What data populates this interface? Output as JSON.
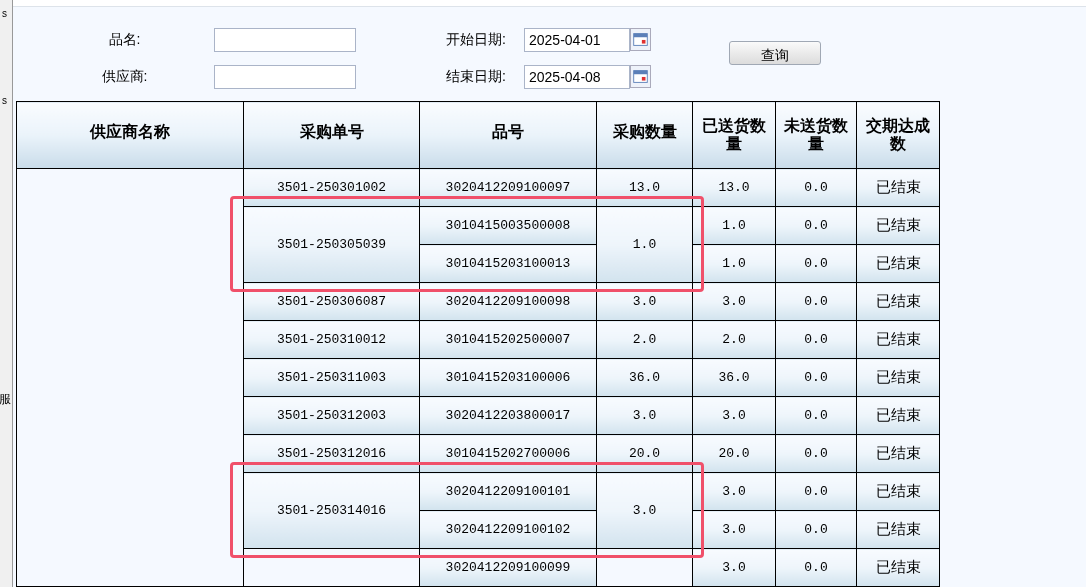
{
  "side_fragments": [
    "s",
    "s",
    "服"
  ],
  "form": {
    "fields": [
      {
        "label": "品名:"
      },
      {
        "label": "供应商:"
      }
    ],
    "dates": [
      {
        "label": "开始日期:",
        "value": "2025-04-01"
      },
      {
        "label": "结束日期:",
        "value": "2025-04-08"
      }
    ],
    "search_button": "查询"
  },
  "table": {
    "columns": [
      "供应商名称",
      "采购单号",
      "品号",
      "采购数量",
      "已送货数量",
      "未送货数量",
      "交期达成数"
    ],
    "orders": [
      {
        "order_no": "3501-250301002",
        "qty": "13.0",
        "highlighted": false,
        "items": [
          {
            "part_no": "3020412209100097",
            "delivered": "13.0",
            "undelivered": "0.0",
            "status": "已结束"
          }
        ]
      },
      {
        "order_no": "3501-250305039",
        "qty": "1.0",
        "highlighted": true,
        "items": [
          {
            "part_no": "3010415003500008",
            "delivered": "1.0",
            "undelivered": "0.0",
            "status": "已结束"
          },
          {
            "part_no": "3010415203100013",
            "delivered": "1.0",
            "undelivered": "0.0",
            "status": "已结束"
          }
        ]
      },
      {
        "order_no": "3501-250306087",
        "qty": "3.0",
        "highlighted": false,
        "items": [
          {
            "part_no": "3020412209100098",
            "delivered": "3.0",
            "undelivered": "0.0",
            "status": "已结束"
          }
        ]
      },
      {
        "order_no": "3501-250310012",
        "qty": "2.0",
        "highlighted": false,
        "items": [
          {
            "part_no": "3010415202500007",
            "delivered": "2.0",
            "undelivered": "0.0",
            "status": "已结束"
          }
        ]
      },
      {
        "order_no": "3501-250311003",
        "qty": "36.0",
        "highlighted": false,
        "items": [
          {
            "part_no": "3010415203100006",
            "delivered": "36.0",
            "undelivered": "0.0",
            "status": "已结束"
          }
        ]
      },
      {
        "order_no": "3501-250312003",
        "qty": "3.0",
        "highlighted": false,
        "items": [
          {
            "part_no": "3020412203800017",
            "delivered": "3.0",
            "undelivered": "0.0",
            "status": "已结束"
          }
        ]
      },
      {
        "order_no": "3501-250312016",
        "qty": "20.0",
        "highlighted": false,
        "items": [
          {
            "part_no": "3010415202700006",
            "delivered": "20.0",
            "undelivered": "0.0",
            "status": "已结束"
          }
        ]
      },
      {
        "order_no": "3501-250314016",
        "qty": "3.0",
        "highlighted": true,
        "items": [
          {
            "part_no": "3020412209100101",
            "delivered": "3.0",
            "undelivered": "0.0",
            "status": "已结束"
          },
          {
            "part_no": "3020412209100102",
            "delivered": "3.0",
            "undelivered": "0.0",
            "status": "已结束"
          }
        ]
      },
      {
        "highlighted": false,
        "items": [
          {
            "part_no": "3020412209100099",
            "delivered": "3.0",
            "undelivered": "0.0",
            "status": "已结束"
          }
        ]
      }
    ]
  }
}
